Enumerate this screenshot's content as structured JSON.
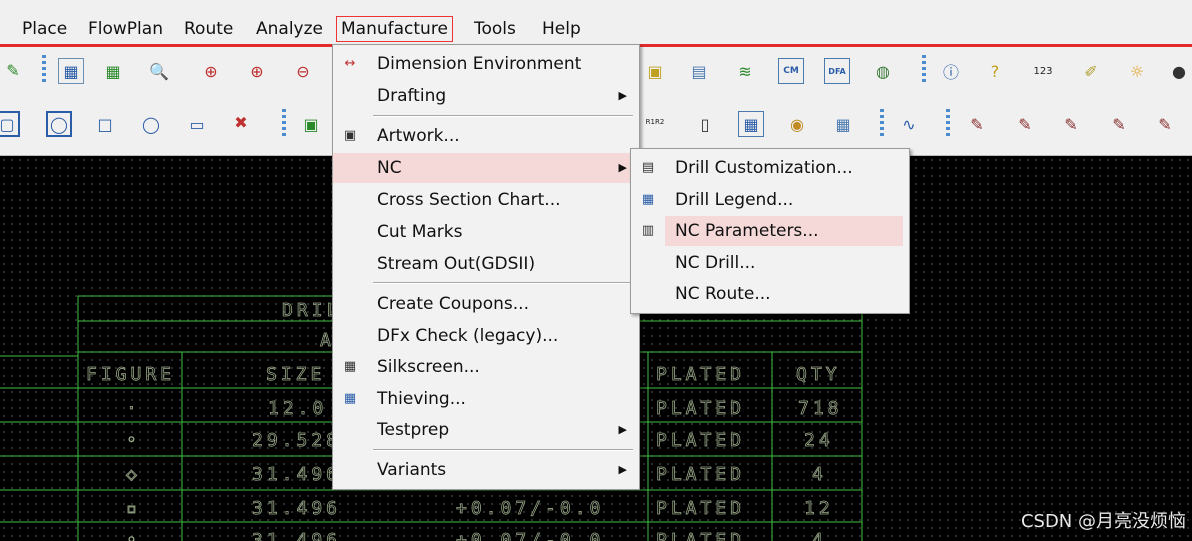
{
  "menubar": {
    "items": [
      "Place",
      "FlowPlan",
      "Route",
      "Analyze",
      "Manufacture",
      "Tools",
      "Help"
    ],
    "active": "Manufacture"
  },
  "toolbar1": {
    "icons": [
      "pin-icon",
      "grid-icon",
      "grid-snap-icon",
      "zoom-fit-icon",
      "zoom-in-icon",
      "zoom-plus-icon",
      "zoom-out-icon",
      "color-icon",
      "layer-icon",
      "stack-icon",
      "cm-icon",
      "dfa-icon",
      "globe-icon",
      "info-icon",
      "help-icon",
      "ruler-icon",
      "brush-icon",
      "sun-icon",
      "bomb-icon"
    ],
    "labels": {
      "cm": "CM",
      "dfa": "DFA",
      "ruler": "123"
    }
  },
  "toolbar2": {
    "icons": [
      "shape-icon",
      "shape-round-icon",
      "square-icon",
      "circle-icon",
      "window-icon",
      "delete-icon",
      "board-icon",
      "r1r2-icon",
      "text-icon",
      "grid-select-icon",
      "tp-icon",
      "array-icon",
      "wave-icon",
      "note1-icon",
      "note2-icon",
      "note3-icon",
      "note4-icon",
      "note5-icon"
    ],
    "labels": {
      "r1r2": "R1R2"
    }
  },
  "manufacture_menu": {
    "items": [
      {
        "label": "Dimension Environment",
        "icon": "dimension-icon",
        "submenu": false
      },
      {
        "label": "Drafting",
        "icon": "",
        "submenu": true
      },
      {
        "label": "Artwork...",
        "icon": "artwork-icon",
        "submenu": false
      },
      {
        "label": "NC",
        "icon": "",
        "submenu": true,
        "highlighted": true
      },
      {
        "label": "Cross Section Chart...",
        "icon": "",
        "submenu": false
      },
      {
        "label": "Cut Marks",
        "icon": "",
        "submenu": false
      },
      {
        "label": "Stream Out(GDSII)",
        "icon": "",
        "submenu": false
      },
      {
        "label": "Create Coupons...",
        "icon": "",
        "submenu": false
      },
      {
        "label": "DFx Check (legacy)...",
        "icon": "",
        "submenu": false
      },
      {
        "label": "Silkscreen...",
        "icon": "silkscreen-icon",
        "submenu": false
      },
      {
        "label": "Thieving...",
        "icon": "thieving-icon",
        "submenu": false
      },
      {
        "label": "Testprep",
        "icon": "",
        "submenu": true
      },
      {
        "label": "Variants",
        "icon": "",
        "submenu": true
      }
    ]
  },
  "nc_menu": {
    "items": [
      {
        "label": "Drill Customization...",
        "icon": "drill-customization-icon"
      },
      {
        "label": "Drill Legend...",
        "icon": "drill-legend-icon"
      },
      {
        "label": "NC Parameters...",
        "icon": "nc-parameters-icon",
        "highlighted": true
      },
      {
        "label": "NC Drill...",
        "icon": ""
      },
      {
        "label": "NC Route...",
        "icon": ""
      }
    ]
  },
  "drill_table": {
    "title": "DRIL",
    "subtitle": "A",
    "headers": [
      "FIGURE",
      "SIZE",
      "PLATED",
      "QTY"
    ],
    "rows": [
      {
        "figure": "·",
        "size": "12.0",
        "tol": "",
        "plated": "PLATED",
        "qty": "718"
      },
      {
        "figure": "◦",
        "size": "29.528",
        "tol": "",
        "plated": "PLATED",
        "qty": "24"
      },
      {
        "figure": "◇",
        "size": "31.496",
        "tol": "",
        "plated": "PLATED",
        "qty": "4"
      },
      {
        "figure": "▫",
        "size": "31.496",
        "tol": "+0.07/-0.0",
        "plated": "PLATED",
        "qty": "12"
      },
      {
        "figure": "◦",
        "size": "31.496",
        "tol": "+0.07/-0.0",
        "plated": "PLATED",
        "qty": "4"
      }
    ]
  },
  "watermark": "CSDN @月亮没烦恼"
}
